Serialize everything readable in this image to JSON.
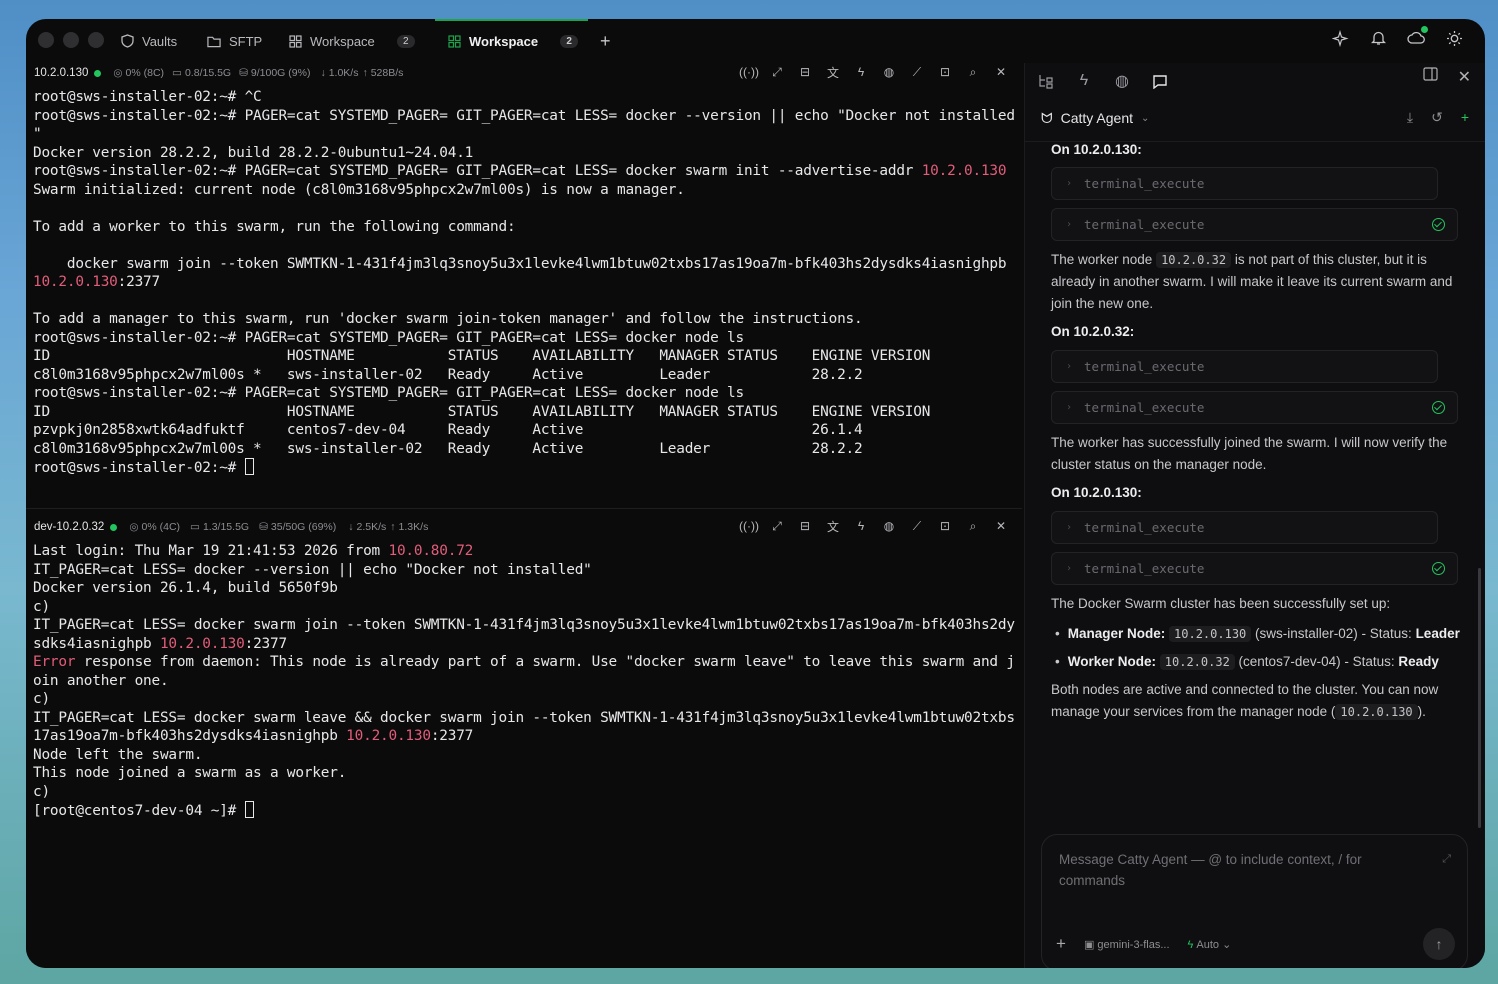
{
  "tabs": [
    {
      "label": "Vaults",
      "icon": "shield-icon"
    },
    {
      "label": "SFTP",
      "icon": "folder-icon"
    },
    {
      "label": "Workspace",
      "icon": "grid-icon",
      "badge": "2"
    },
    {
      "label": "Workspace",
      "icon": "grid-icon",
      "badge": "2",
      "active": true
    }
  ],
  "pane1": {
    "host": "10.2.0.130",
    "cpu": "0% (8C)",
    "mem": "0.8/15.5G",
    "disk": "9/100G (9%)",
    "down": "1.0K/s",
    "up": "528B/s"
  },
  "pane2": {
    "host": "dev-10.2.0.32",
    "cpu": "0% (4C)",
    "mem": "1.3/15.5G",
    "disk": "35/50G (69%)",
    "down": "2.5K/s",
    "up": "1.3K/s"
  },
  "term1": {
    "l1": "root@sws-installer-02:~# ^C",
    "l2": "root@sws-installer-02:~# PAGER=cat SYSTEMD_PAGER= GIT_PAGER=cat LESS= docker --version || echo \"Docker not installed",
    "l3": "\"",
    "l4": "Docker version 28.2.2, build 28.2.2-0ubuntu1~24.04.1",
    "l5a": "root@sws-installer-02:~# PAGER=cat SYSTEMD_PAGER= GIT_PAGER=cat LESS= docker swarm init --advertise-addr ",
    "l5b": "10.2.0.130",
    "l6": "Swarm initialized: current node (c8l0m3168v95phpcx2w7ml00s) is now a manager.",
    "l7": "",
    "l8": "To add a worker to this swarm, run the following command:",
    "l9": "",
    "l10": "    docker swarm join --token SWMTKN-1-431f4jm3lq3snoy5u3x1levke4lwm1btuw02txbs17as19oa7m-bfk403hs2dysdks4iasnighpb",
    "l11a": "10.2.0.130",
    "l11b": ":2377",
    "l12": "",
    "l13": "To add a manager to this swarm, run 'docker swarm join-token manager' and follow the instructions.",
    "l14": "root@sws-installer-02:~# PAGER=cat SYSTEMD_PAGER= GIT_PAGER=cat LESS= docker node ls",
    "l15": "ID                            HOSTNAME           STATUS    AVAILABILITY   MANAGER STATUS    ENGINE VERSION",
    "l16": "c8l0m3168v95phpcx2w7ml00s *   sws-installer-02   Ready     Active         Leader            28.2.2",
    "l17": "root@sws-installer-02:~# PAGER=cat SYSTEMD_PAGER= GIT_PAGER=cat LESS= docker node ls",
    "l18": "ID                            HOSTNAME           STATUS    AVAILABILITY   MANAGER STATUS    ENGINE VERSION",
    "l19": "pzvpkj0n2858xwtk64adfuktf     centos7-dev-04     Ready     Active                           26.1.4",
    "l20": "c8l0m3168v95phpcx2w7ml00s *   sws-installer-02   Ready     Active         Leader            28.2.2",
    "l21": "root@sws-installer-02:~# "
  },
  "term2": {
    "l1a": "Last login: Thu Mar 19 21:41:53 2026 from ",
    "l1b": "10.0.80.72",
    "l2": "IT_PAGER=cat LESS= docker --version || echo \"Docker not installed\"",
    "l3": "Docker version 26.1.4, build 5650f9b",
    "l4": "c)",
    "l5": "IT_PAGER=cat LESS= docker swarm join --token SWMTKN-1-431f4jm3lq3snoy5u3x1levke4lwm1btuw02txbs17as19oa7m-bfk403hs2dy",
    "l6a": "sdks4iasnighpb ",
    "l6b": "10.2.0.130",
    "l6c": ":2377",
    "l7a": "Error",
    "l7b": " response from daemon: This node is already part of a swarm. Use \"docker swarm leave\" to leave this swarm and j",
    "l8": "oin another one.",
    "l9": "c)",
    "l10": "IT_PAGER=cat LESS= docker swarm leave && docker swarm join --token SWMTKN-1-431f4jm3lq3snoy5u3x1levke4lwm1btuw02txbs",
    "l11a": "17as19oa7m-bfk403hs2dysdks4iasnighpb ",
    "l11b": "10.2.0.130",
    "l11c": ":2377",
    "l12": "Node left the swarm.",
    "l13": "This node joined a swarm as a worker.",
    "l14": "c)",
    "l15": "[root@centos7-dev-04 ~]# "
  },
  "agent": {
    "name": "Catty Agent",
    "on1": "On 10.2.0.130:",
    "tool": "terminal_execute",
    "msg1a": "The worker node ",
    "msg1code": "10.2.0.32",
    "msg1b": " is not part of this cluster, but it is already in another swarm. I will make it leave its current swarm and join the new one.",
    "on2": "On 10.2.0.32:",
    "msg2": "The worker has successfully joined the swarm. I will now verify the cluster status on the manager node.",
    "on3": "On 10.2.0.130:",
    "msg3": "The Docker Swarm cluster has been successfully set up:",
    "b1label": "Manager Node:",
    "b1code": "10.2.0.130",
    "b1rest": " (sws-installer-02) - Status: ",
    "b1status": "Leader",
    "b2label": "Worker Node:",
    "b2code": "10.2.0.32",
    "b2rest": " (centos7-dev-04) - Status: ",
    "b2status": "Ready",
    "msg4a": "Both nodes are active and connected to the cluster. You can now manage your services from the manager node (",
    "msg4code": "10.2.0.130",
    "msg4b": ")."
  },
  "input": {
    "placeholder": "Message Catty Agent — @ to include context, / for commands",
    "model": "gemini-3-flas...",
    "mode": "Auto"
  }
}
